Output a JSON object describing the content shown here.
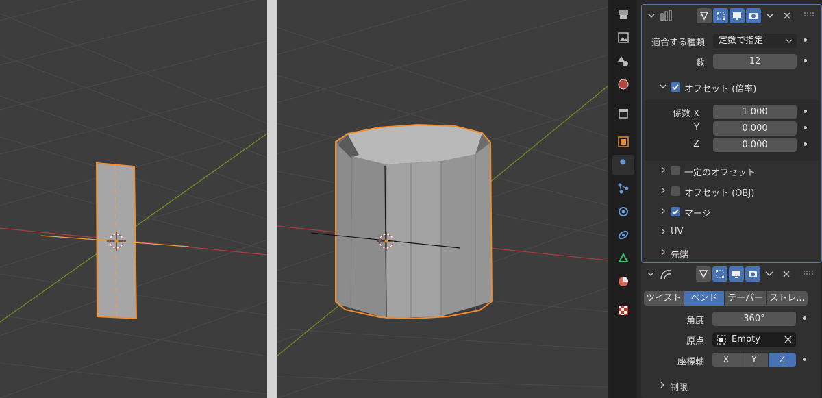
{
  "array_modifier": {
    "fit_type_label": "適合する種類",
    "fit_type_value": "定数で指定",
    "count_label": "数",
    "count_value": "12",
    "relative_offset_label": "オフセット (倍率)",
    "relative_offset_checked": true,
    "factor_x_label": "係数 X",
    "factor_x_value": "1.000",
    "factor_y_label": "Y",
    "factor_y_value": "0.000",
    "factor_z_label": "Z",
    "factor_z_value": "0.000",
    "constant_offset_label": "一定のオフセット",
    "object_offset_label": "オフセット (OBJ)",
    "merge_label": "マージ",
    "uv_label": "UV",
    "caps_label": "先端"
  },
  "simple_deform_modifier": {
    "modes": [
      "ツイスト",
      "ベンド",
      "テーパー",
      "ストレ..."
    ],
    "active_mode": "ベンド",
    "angle_label": "角度",
    "angle_value": "360°",
    "origin_label": "原点",
    "origin_value": "Empty",
    "axis_label": "座標軸",
    "axes": [
      "X",
      "Y",
      "Z"
    ],
    "active_axis": "Z",
    "restrictions_label": "制限"
  },
  "property_tabs": [
    "tool",
    "render",
    "output",
    "view-layer",
    "scene",
    "world",
    "collection",
    "object",
    "modifiers",
    "particles",
    "physics",
    "constraints",
    "data",
    "material",
    "texture"
  ],
  "active_tab": "modifiers",
  "colors": {
    "accent": "#4772b3",
    "selection_outline": "#f08d2c",
    "viewport_bg": "#3d3d3d",
    "x_axis": "#a83b3b",
    "y_axis": "#6b8f23"
  }
}
